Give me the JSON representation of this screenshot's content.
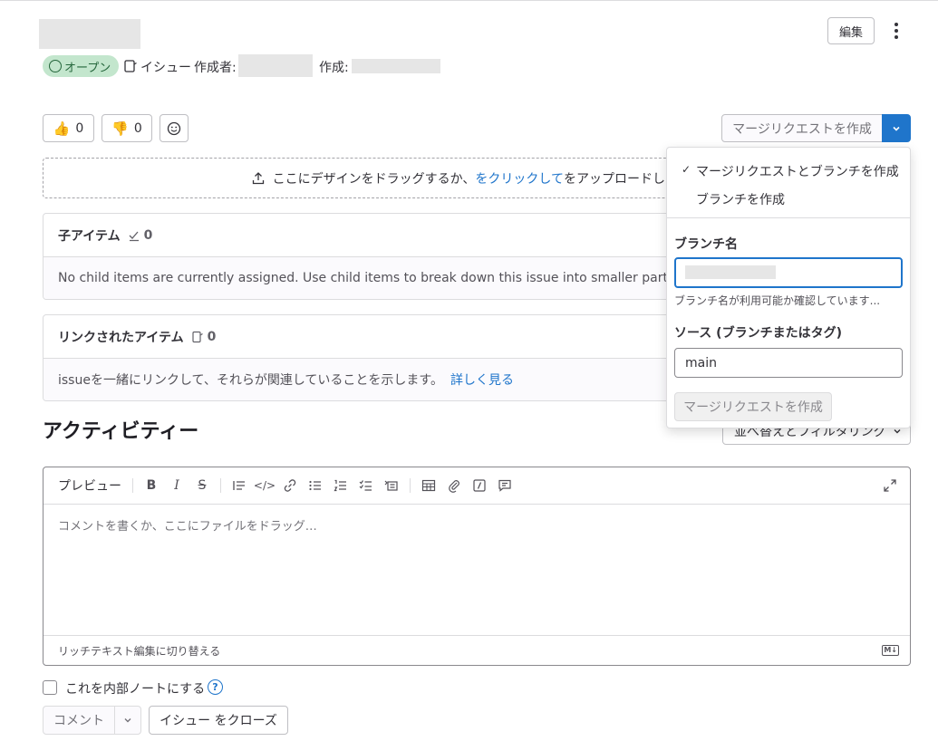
{
  "header": {
    "edit_label": "編集",
    "status_label": "オープン",
    "type_label": "イシュー",
    "author_label": "作成者:",
    "created_label": "作成:"
  },
  "reactions": {
    "thumbs_up_count": "0",
    "thumbs_down_count": "0"
  },
  "merge_button": {
    "label": "マージリクエストを作成"
  },
  "upload": {
    "prefix": "ここにデザインをドラッグするか、",
    "link": "をクリックして",
    "suffix": "をアップロードし"
  },
  "child_items": {
    "title": "子アイテム",
    "count": "0",
    "empty_text": "No child items are currently assigned. Use child items to break down this issue into smaller parts."
  },
  "linked_items": {
    "title": "リンクされたアイテム",
    "count": "0",
    "text": "issueを一緒にリンクして、それらが関連していることを示します。",
    "link": "詳しく見る"
  },
  "activity": {
    "title": "アクティビティー",
    "sort_label": "並べ替えとフィルタリング"
  },
  "editor": {
    "preview_label": "プレビュー",
    "placeholder": "コメントを書くか、ここにファイルをドラッグ…",
    "rich_text_toggle": "リッチテキスト編集に切り替える",
    "markdown_badge": "M↓"
  },
  "internal_note_label": "これを内部ノートにする",
  "comment_button": "コメント",
  "close_issue_button": "イシュー をクローズ",
  "dropdown": {
    "option_mr_and_branch": "マージリクエストとブランチを作成",
    "option_branch": "ブランチを作成",
    "branch_name_label": "ブランチ名",
    "branch_check_text": "ブランチ名が利用可能か確認しています...",
    "source_label": "ソース (ブランチまたはタグ)",
    "source_value": "main",
    "submit_label": "マージリクエストを作成"
  }
}
